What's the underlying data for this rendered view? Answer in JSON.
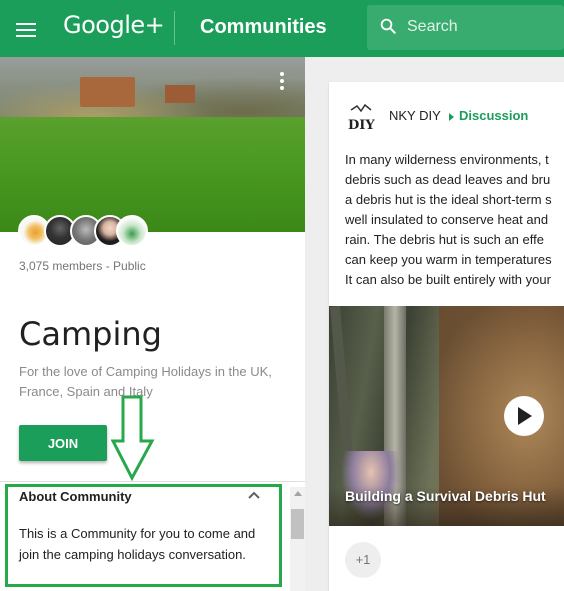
{
  "topbar": {
    "logo": "Google+",
    "section_title": "Communities",
    "search": {
      "placeholder": "Search"
    }
  },
  "community": {
    "members_text": "3,075 members - Public",
    "title": "Camping",
    "tagline": "For the love of Camping Holidays in the UK, France, Spain and Italy",
    "join_label": "JOIN",
    "about": {
      "header": "About Community",
      "text": "This is a Community for you to come and join the camping holidays conversation."
    }
  },
  "post": {
    "avatar_text": "DIY",
    "author": "NKY DIY",
    "category": "Discussion",
    "body_lines": [
      "In many wilderness environments, t",
      "debris such as dead leaves and bru",
      "a debris hut is the ideal short-term s",
      "well insulated to conserve heat and",
      "rain.  The debris hut is such an effe",
      "can keep you warm in temperatures",
      "It can also be built entirely with your"
    ],
    "video_title": "Building a Survival Debris Hut",
    "plus_one": "+1"
  },
  "colors": {
    "brand_green": "#1a9e5a",
    "annotation_green": "#27a84a"
  }
}
